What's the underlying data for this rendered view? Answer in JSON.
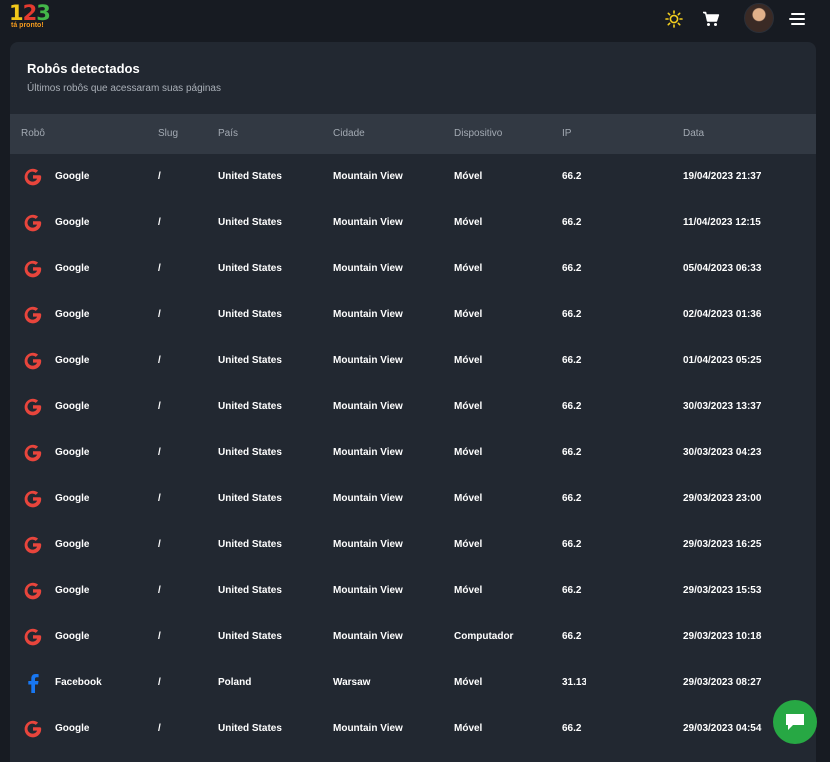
{
  "logo": {
    "digit1": "1",
    "digit2": "2",
    "digit3": "3",
    "subtitle": "tá pronto!"
  },
  "icons": [
    "sun-icon",
    "cart-icon",
    "avatar",
    "menu-icon",
    "google-icon",
    "facebook-icon",
    "chat-icon"
  ],
  "colors": {
    "background": "#171b22",
    "card": "#222831",
    "table_header": "#323943",
    "google_red": "#e8453c",
    "facebook_blue": "#1877f2",
    "chat_green": "#27a844"
  },
  "card": {
    "title": "Robôs detectados",
    "subtitle": "Últimos robôs que acessaram suas páginas"
  },
  "table": {
    "headers": [
      "Robô",
      "Slug",
      "País",
      "Cidade",
      "Dispositivo",
      "IP",
      "Data"
    ],
    "rows": [
      {
        "robot": "Google",
        "icon": "google",
        "slug": "/",
        "country": "United States",
        "city": "Mountain View",
        "device": "Móvel",
        "ip": "66.2",
        "date": "19/04/2023 21:37"
      },
      {
        "robot": "Google",
        "icon": "google",
        "slug": "/",
        "country": "United States",
        "city": "Mountain View",
        "device": "Móvel",
        "ip": "66.2",
        "date": "11/04/2023 12:15"
      },
      {
        "robot": "Google",
        "icon": "google",
        "slug": "/",
        "country": "United States",
        "city": "Mountain View",
        "device": "Móvel",
        "ip": "66.2",
        "date": "05/04/2023 06:33"
      },
      {
        "robot": "Google",
        "icon": "google",
        "slug": "/",
        "country": "United States",
        "city": "Mountain View",
        "device": "Móvel",
        "ip": "66.2",
        "date": "02/04/2023 01:36"
      },
      {
        "robot": "Google",
        "icon": "google",
        "slug": "/",
        "country": "United States",
        "city": "Mountain View",
        "device": "Móvel",
        "ip": "66.2",
        "date": "01/04/2023 05:25"
      },
      {
        "robot": "Google",
        "icon": "google",
        "slug": "/",
        "country": "United States",
        "city": "Mountain View",
        "device": "Móvel",
        "ip": "66.2",
        "date": "30/03/2023 13:37"
      },
      {
        "robot": "Google",
        "icon": "google",
        "slug": "/",
        "country": "United States",
        "city": "Mountain View",
        "device": "Móvel",
        "ip": "66.2",
        "date": "30/03/2023 04:23"
      },
      {
        "robot": "Google",
        "icon": "google",
        "slug": "/",
        "country": "United States",
        "city": "Mountain View",
        "device": "Móvel",
        "ip": "66.2",
        "date": "29/03/2023 23:00"
      },
      {
        "robot": "Google",
        "icon": "google",
        "slug": "/",
        "country": "United States",
        "city": "Mountain View",
        "device": "Móvel",
        "ip": "66.2",
        "date": "29/03/2023 16:25"
      },
      {
        "robot": "Google",
        "icon": "google",
        "slug": "/",
        "country": "United States",
        "city": "Mountain View",
        "device": "Móvel",
        "ip": "66.2",
        "date": "29/03/2023 15:53"
      },
      {
        "robot": "Google",
        "icon": "google",
        "slug": "/",
        "country": "United States",
        "city": "Mountain View",
        "device": "Computador",
        "ip": "66.2",
        "date": "29/03/2023 10:18"
      },
      {
        "robot": "Facebook",
        "icon": "facebook",
        "slug": "/",
        "country": "Poland",
        "city": "Warsaw",
        "device": "Móvel",
        "ip": "31.13",
        "date": "29/03/2023 08:27"
      },
      {
        "robot": "Google",
        "icon": "google",
        "slug": "/",
        "country": "United States",
        "city": "Mountain View",
        "device": "Móvel",
        "ip": "66.2",
        "date": "29/03/2023 04:54"
      }
    ]
  }
}
